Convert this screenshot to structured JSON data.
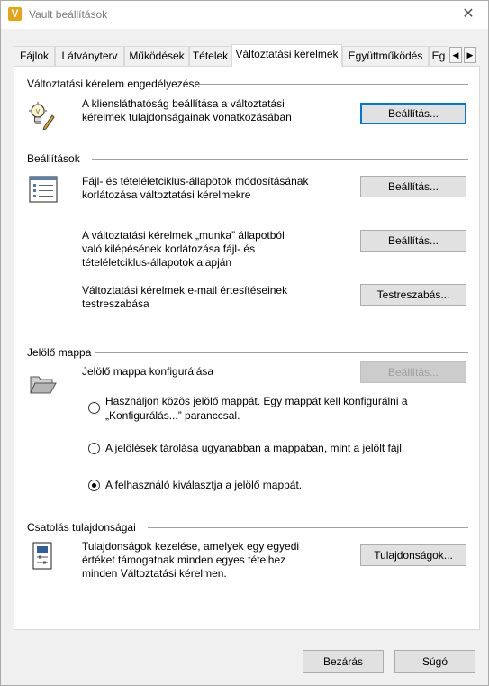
{
  "window": {
    "title": "Vault beállítások",
    "logo_letter": "V",
    "close_glyph": "✕"
  },
  "tabs": [
    {
      "label": "Fájlok"
    },
    {
      "label": "Látványterv"
    },
    {
      "label": "Működések"
    },
    {
      "label": "Tételek"
    },
    {
      "label": "Változtatási kérelmek",
      "active": true
    },
    {
      "label": "Együttműködés"
    },
    {
      "label": "Eg"
    }
  ],
  "tab_scroll": {
    "left": "◀",
    "right": "▶"
  },
  "sections": {
    "enable": {
      "title": "Változtatási kérelem engedélyezése",
      "description_l1": "A kliensláthatóság beállítása a változtatási",
      "description_l2": "kérelmek tulajdonságainak vonatkozásában",
      "button": "Beállítás..."
    },
    "settings": {
      "title": "Beállítások",
      "item1_l1": "Fájl- és tételéletciklus-állapotok módosításának",
      "item1_l2": "korlátozása változtatási kérelmekre",
      "item1_button": "Beállítás...",
      "item2_l1": "A változtatási kérelmek „munka” állapotból",
      "item2_l2": "való kilépésének korlátozása fájl- és",
      "item2_l3": "tételéletciklus-állapotok alapján",
      "item2_button": "Beállítás...",
      "item3_l1": "Változtatási kérelmek e-mail értesítéseinek",
      "item3_l2": "testreszabása",
      "item3_button": "Testreszabás..."
    },
    "markup": {
      "title": "Jelölő mappa",
      "configure_label": "Jelölő mappa konfigurálása",
      "button": "Beállítás...",
      "options": [
        {
          "l1": "Használjon közös jelölő mappát. Egy mappát kell konfigurálni a",
          "l2": "„Konfigurálás...” paranccsal.",
          "checked": false
        },
        {
          "l1": "A jelölések tárolása ugyanabban a mappában, mint a jelölt fájl.",
          "checked": false
        },
        {
          "l1": "A felhasználó kiválasztja a jelölő mappát.",
          "checked": true
        }
      ]
    },
    "attachment": {
      "title": "Csatolás tulajdonságai",
      "description_l1": "Tulajdonságok kezelése, amelyek egy egyedi",
      "description_l2": "értéket támogatnak minden egyes tételhez",
      "description_l3": "minden Változtatási kérelmen.",
      "button": "Tulajdonságok..."
    }
  },
  "footer": {
    "close_button": "Bezárás",
    "help_button": "Súgó"
  },
  "colors": {
    "accent_focus": "#0078d7",
    "logo": "#e8a317"
  }
}
